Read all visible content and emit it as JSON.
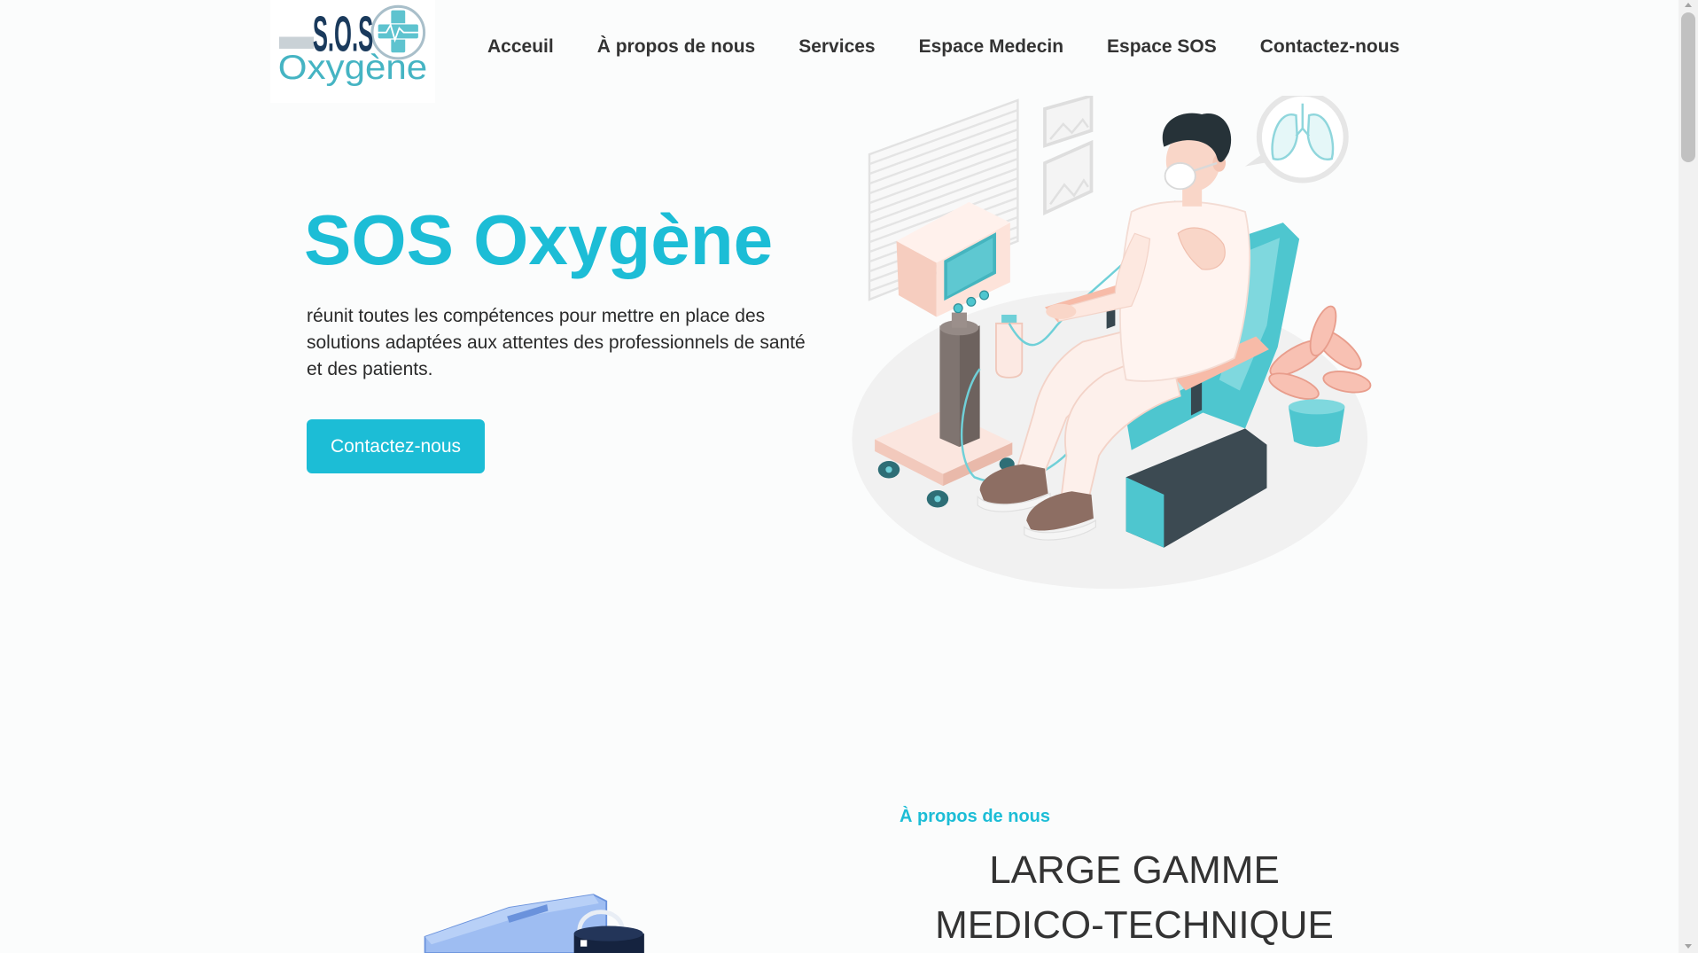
{
  "brand": {
    "name_top": "S.O.S",
    "name_bottom": "Oxygène"
  },
  "nav": {
    "items": [
      {
        "label": "Acceuil"
      },
      {
        "label": "À propos de nous"
      },
      {
        "label": "Services"
      },
      {
        "label": "Espace Medecin"
      },
      {
        "label": "Espace SOS"
      },
      {
        "label": "Contactez-nous"
      }
    ]
  },
  "hero": {
    "title": "SOS Oxygène",
    "description_lines": [
      "réunit toutes les compétences pour mettre en place des",
      "solutions adaptées aux attentes des professionnels de santé",
      "et des patients."
    ],
    "cta_label": "Contactez-nous",
    "illustration": "patient-oxygen-therapy-illustration"
  },
  "about": {
    "eyebrow": "À propos de nous",
    "heading_lines": [
      "LARGE GAMME",
      "MEDICO-TECHNIQUE"
    ],
    "illustration": "medical-device-illustration"
  },
  "colors": {
    "accent": "#1cbdd6",
    "text": "#333333",
    "background": "#fbfcfc",
    "logo_navy": "#1a3a5c",
    "chair_teal": "#4ec6cf"
  }
}
